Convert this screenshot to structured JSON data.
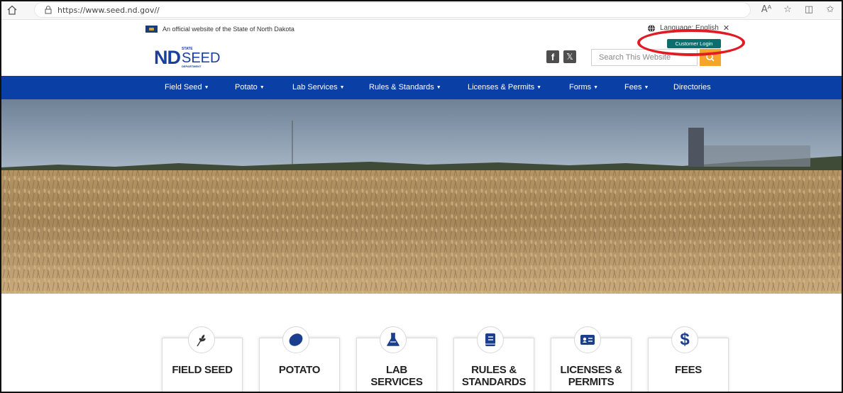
{
  "browser": {
    "url": "https://www.seed.nd.gov//",
    "read_aloud_icon": "Aᴬ"
  },
  "header": {
    "official_banner": "An official website of the State of North Dakota",
    "language_label": "Language: English",
    "customer_login": "Customer Login",
    "search_placeholder": "Search This Website"
  },
  "logo": {
    "nd": "ND",
    "state": "STATE",
    "seed": "SEED",
    "department": "DEPARTMENT"
  },
  "nav": {
    "items": [
      {
        "label": "Field Seed",
        "dropdown": true
      },
      {
        "label": "Potato",
        "dropdown": true
      },
      {
        "label": "Lab Services",
        "dropdown": true
      },
      {
        "label": "Rules & Standards",
        "dropdown": true
      },
      {
        "label": "Licenses & Permits",
        "dropdown": true
      },
      {
        "label": "Forms",
        "dropdown": true
      },
      {
        "label": "Fees",
        "dropdown": true
      },
      {
        "label": "Directories",
        "dropdown": false
      }
    ]
  },
  "cards": [
    {
      "line1": "FIELD SEED",
      "line2": "",
      "icon": "wheat-icon"
    },
    {
      "line1": "POTATO",
      "line2": "",
      "icon": "potato-icon"
    },
    {
      "line1": "LAB",
      "line2": "SERVICES",
      "icon": "flask-icon"
    },
    {
      "line1": "RULES &",
      "line2": "STANDARDS",
      "icon": "book-icon"
    },
    {
      "line1": "LICENSES &",
      "line2": "PERMITS",
      "icon": "id-card-icon"
    },
    {
      "line1": "FEES",
      "line2": "",
      "icon": "dollar-icon"
    }
  ],
  "colors": {
    "nav_blue": "#0a3fa6",
    "logo_blue": "#1a3f9c",
    "login_teal": "#0d6e6e",
    "search_orange": "#f4a52a",
    "annotation_red": "#e01b24"
  }
}
